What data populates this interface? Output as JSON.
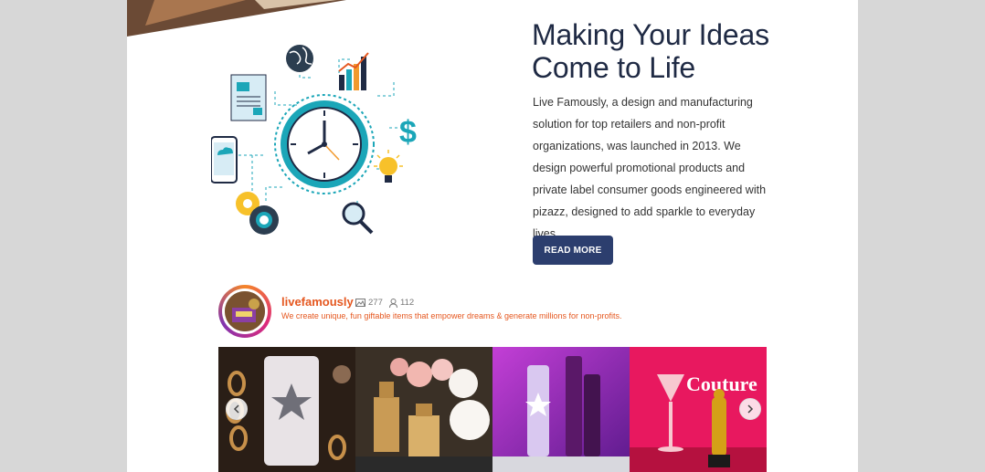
{
  "about": {
    "heading_line1": "Making Your Ideas",
    "heading_line2": "Come to Life",
    "body": "Live Famously, a design and manufacturing solution for top retailers and non-profit organizations, was launched in 2013. We design powerful promotional products and private label consumer goods engineered with pizazz, designed to add sparkle to everyday lives.",
    "button_label": "READ MORE"
  },
  "instagram": {
    "username": "livefamously",
    "posts_count": "277",
    "followers_count": "112",
    "bio": "We create unique, fun giftable items that empower dreams & generate millions for non-profits.",
    "tile4_text": "Couture",
    "prev_icon": "chevron-left-icon",
    "next_icon": "chevron-right-icon"
  },
  "colors": {
    "button": "#2c3e6e",
    "heading": "#1f2a44",
    "brand_orange": "#e5571f",
    "clock_teal": "#1ba6b8"
  }
}
